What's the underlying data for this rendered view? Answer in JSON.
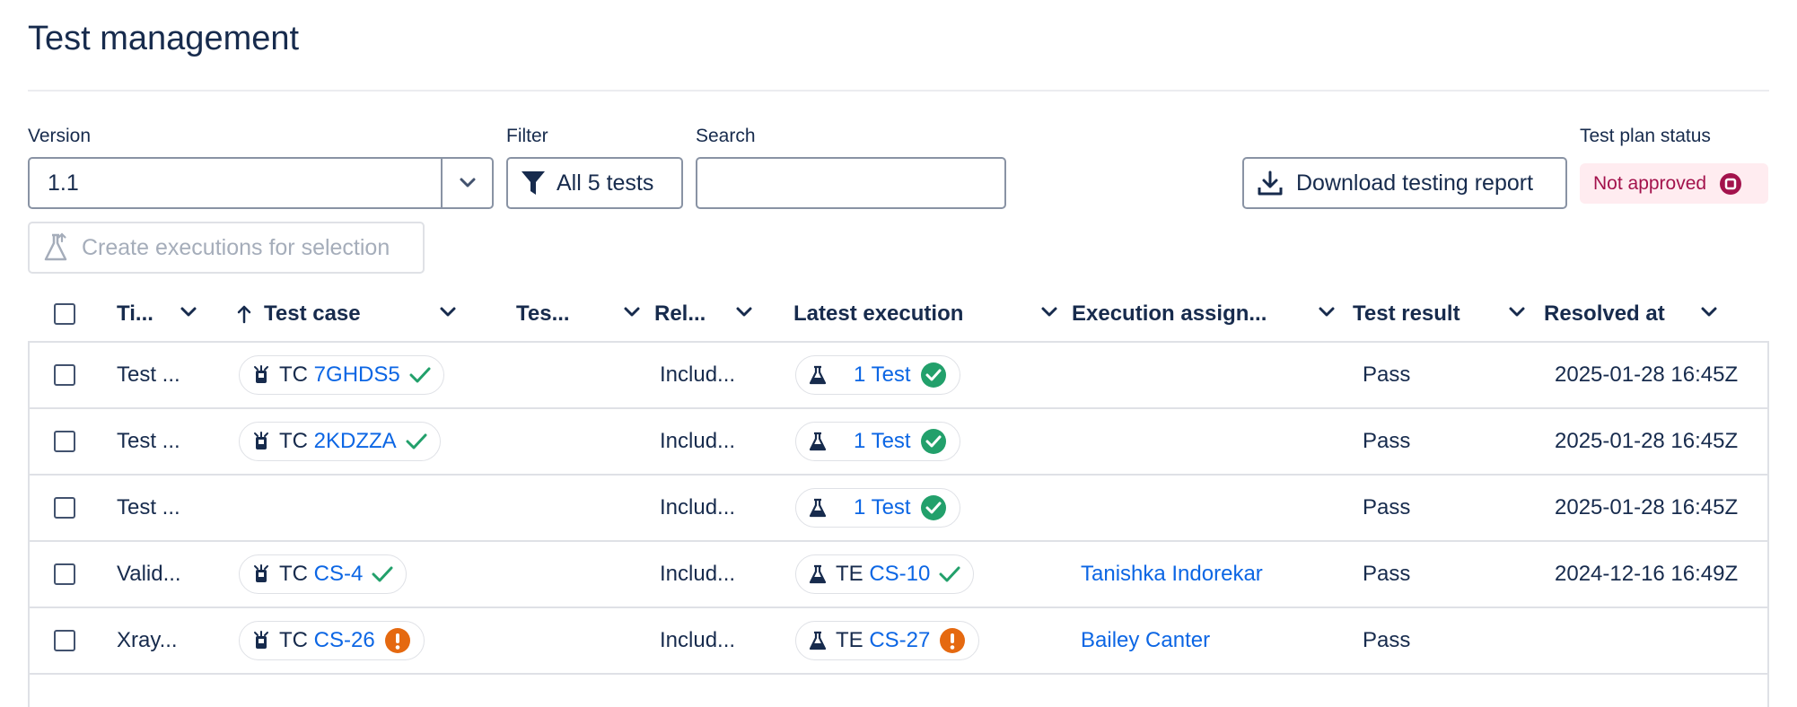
{
  "page": {
    "title": "Test management"
  },
  "controls": {
    "version_label": "Version",
    "version_value": "1.1",
    "filter_label": "Filter",
    "filter_button": "All 5 tests",
    "search_label": "Search",
    "search_placeholder": "",
    "download_button": "Download testing report",
    "status_label": "Test plan status",
    "status_value": "Not approved",
    "create_button": "Create executions for selection"
  },
  "colors": {
    "link": "#0c66e4",
    "success": "#22a06b",
    "warning": "#e56910",
    "status_bg": "#ffecf0",
    "status_text": "#a3124c"
  },
  "table": {
    "columns": [
      "Ti...",
      "Test case",
      "Tes...",
      "Rel...",
      "Latest execution",
      "Execution assign...",
      "Test result",
      "Resolved at"
    ],
    "rows": [
      {
        "title": "Test ...",
        "tc_prefix": "TC",
        "tc_key": "7GHDS5",
        "tc_status": "check",
        "release": "Includ...",
        "ex_prefix": "",
        "ex_key": "1 Test",
        "ex_status": "check-circle",
        "assignee": "",
        "result": "Pass",
        "resolved": "2025-01-28 16:45Z"
      },
      {
        "title": "Test ...",
        "tc_prefix": "TC",
        "tc_key": "2KDZZA",
        "tc_status": "check",
        "release": "Includ...",
        "ex_prefix": "",
        "ex_key": "1 Test",
        "ex_status": "check-circle",
        "assignee": "",
        "result": "Pass",
        "resolved": "2025-01-28 16:45Z"
      },
      {
        "title": "Test ...",
        "tc_prefix": "",
        "tc_key": "",
        "tc_status": "",
        "release": "Includ...",
        "ex_prefix": "",
        "ex_key": "1 Test",
        "ex_status": "check-circle",
        "assignee": "",
        "result": "Pass",
        "resolved": "2025-01-28 16:45Z"
      },
      {
        "title": "Valid...",
        "tc_prefix": "TC",
        "tc_key": "CS-4",
        "tc_status": "check",
        "release": "Includ...",
        "ex_prefix": "TE",
        "ex_key": "CS-10",
        "ex_status": "check",
        "assignee": "Tanishka Indorekar",
        "result": "Pass",
        "resolved": "2024-12-16 16:49Z"
      },
      {
        "title": "Xray...",
        "tc_prefix": "TC",
        "tc_key": "CS-26",
        "tc_status": "warning",
        "release": "Includ...",
        "ex_prefix": "TE",
        "ex_key": "CS-27",
        "ex_status": "warning",
        "assignee": "Bailey Canter",
        "result": "Pass",
        "resolved": ""
      }
    ]
  }
}
